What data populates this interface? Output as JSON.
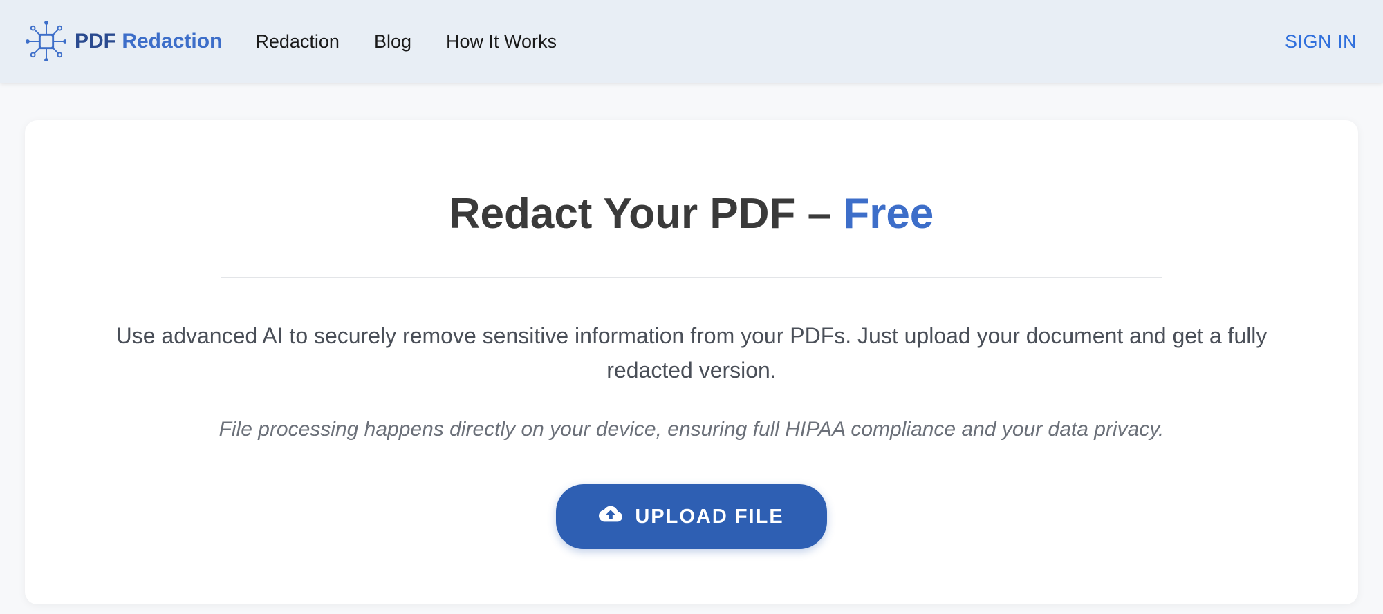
{
  "header": {
    "logo": {
      "text_pdf": "PDF",
      "text_redaction": " Redaction"
    },
    "nav": {
      "redaction": "Redaction",
      "blog": "Blog",
      "how_it_works": "How It Works"
    },
    "signin": "SIGN IN"
  },
  "hero": {
    "title_main": "Redact Your PDF – ",
    "title_highlight": "Free",
    "description": "Use advanced AI to securely remove sensitive information from your PDFs. Just upload your document and get a fully redacted version.",
    "privacy_note": "File processing happens directly on your device, ensuring full HIPAA compliance and your data privacy.",
    "upload_button": "UPLOAD FILE"
  }
}
